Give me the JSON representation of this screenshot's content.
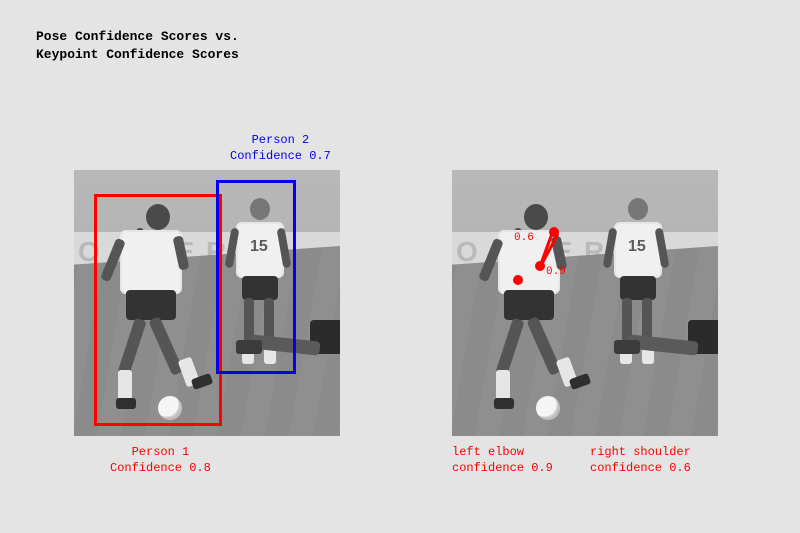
{
  "title": "Pose Confidence Scores vs.\nKeypoint Confidence Scores",
  "banner_text": "O C C E R",
  "jersey_number": "15",
  "left": {
    "p1": {
      "label": "Person 1\nConfidence 0.8"
    },
    "p2": {
      "label": "Person 2\nConfidence 0.7"
    }
  },
  "right": {
    "kp_a_val": "0.6",
    "kp_b_val": "0.9",
    "elbow": {
      "label": "left elbow\nconfidence 0.9"
    },
    "shoulder": {
      "label": "right shoulder\nconfidence 0.6"
    }
  }
}
